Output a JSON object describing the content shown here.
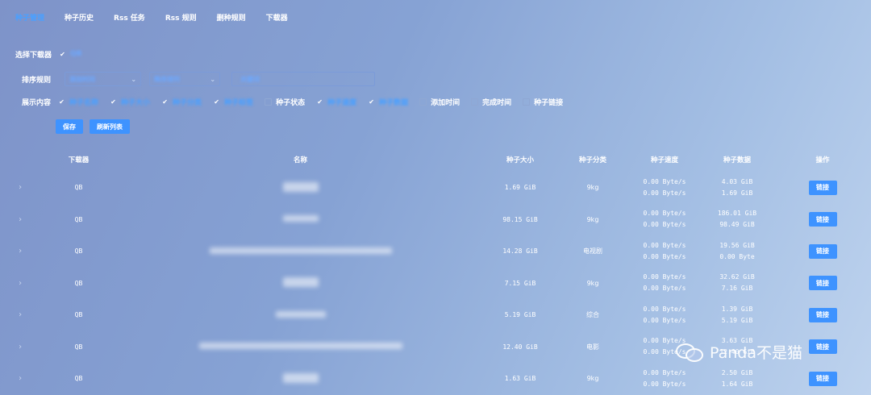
{
  "nav": {
    "tabs": [
      {
        "label": "种子管理"
      },
      {
        "label": "种子历史"
      },
      {
        "label": "Rss 任务"
      },
      {
        "label": "Rss 规则"
      },
      {
        "label": "删种规则"
      },
      {
        "label": "下载器"
      }
    ]
  },
  "filters": {
    "downloader_label": "选择下载器",
    "downloader_value": "QB",
    "sort_label": "排序规则",
    "sort_field": "添加时间",
    "sort_order": "降序排列",
    "search_placeholder": "关键词",
    "show_label": "展示内容",
    "show_options": [
      {
        "label": "种子名称",
        "checked": true
      },
      {
        "label": "种子大小",
        "checked": true
      },
      {
        "label": "种子分类",
        "checked": true
      },
      {
        "label": "种子标签",
        "checked": true
      },
      {
        "label": "种子状态",
        "checked": false
      },
      {
        "label": "种子速度",
        "checked": true
      },
      {
        "label": "种子数据",
        "checked": true
      },
      {
        "label": "添加时间",
        "checked": false
      },
      {
        "label": "完成时间",
        "checked": false
      },
      {
        "label": "种子链接",
        "checked": false
      }
    ]
  },
  "actions": {
    "save": "保存",
    "refresh": "刷新列表"
  },
  "table": {
    "headers": {
      "downloader": "下载器",
      "name": "名称",
      "size": "种子大小",
      "category": "种子分类",
      "speed": "种子速度",
      "data": "种子数据",
      "ops": "操作"
    },
    "rows": [
      {
        "downloader": "QB",
        "size": "1.69 GiB",
        "category": "9kg",
        "up": "0.00 Byte/s",
        "down": "0.00 Byte/s",
        "uploaded": "4.03 GiB",
        "downloaded": "1.69 GiB",
        "op": "链接"
      },
      {
        "downloader": "QB",
        "size": "98.15 GiB",
        "category": "9kg",
        "up": "0.00 Byte/s",
        "down": "0.00 Byte/s",
        "uploaded": "186.01 GiB",
        "downloaded": "98.49 GiB",
        "op": "链接"
      },
      {
        "downloader": "QB",
        "size": "14.28 GiB",
        "category": "电视剧",
        "up": "0.00 Byte/s",
        "down": "0.00 Byte/s",
        "uploaded": "19.56 GiB",
        "downloaded": "0.00 Byte",
        "op": "链接"
      },
      {
        "downloader": "QB",
        "size": "7.15 GiB",
        "category": "9kg",
        "up": "0.00 Byte/s",
        "down": "0.00 Byte/s",
        "uploaded": "32.62 GiB",
        "downloaded": "7.16 GiB",
        "op": "链接"
      },
      {
        "downloader": "QB",
        "size": "5.19 GiB",
        "category": "综合",
        "up": "0.00 Byte/s",
        "down": "0.00 Byte/s",
        "uploaded": "1.39 GiB",
        "downloaded": "5.19 GiB",
        "op": "链接"
      },
      {
        "downloader": "QB",
        "size": "12.40 GiB",
        "category": "电影",
        "up": "0.00 Byte/s",
        "down": "0.00 Byte/s",
        "uploaded": "3.63 GiB",
        "downloaded": "12.40 GiB",
        "op": "链接"
      },
      {
        "downloader": "QB",
        "size": "1.63 GiB",
        "category": "9kg",
        "up": "0.00 Byte/s",
        "down": "0.00 Byte/s",
        "uploaded": "2.50 GiB",
        "downloaded": "1.64 GiB",
        "op": "链接"
      }
    ]
  },
  "watermark": {
    "text": "Panda不是猫"
  }
}
